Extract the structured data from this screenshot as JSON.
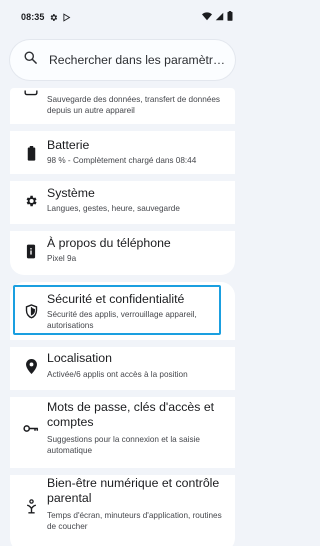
{
  "status_bar": {
    "time": "08:35"
  },
  "search": {
    "placeholder": "Rechercher dans les paramètr…"
  },
  "items": [
    {
      "title": "",
      "subtitle": "Sauvegarde des données, transfert de données depuis un autre appareil",
      "icon": "backup-icon"
    },
    {
      "title": "Batterie",
      "subtitle": "98 % - Complètement chargé dans 08:44",
      "icon": "battery-icon"
    },
    {
      "title": "Système",
      "subtitle": "Langues, gestes, heure, sauvegarde",
      "icon": "gear-icon"
    },
    {
      "title": "À propos du téléphone",
      "subtitle": "Pixel 9a",
      "icon": "phone-icon"
    },
    {
      "title": "Sécurité et confidentialité",
      "subtitle": "Sécurité des applis, verrouillage appareil, autorisations",
      "icon": "shield-icon"
    },
    {
      "title": "Localisation",
      "subtitle": "Activée/6 applis ont accès à la position",
      "icon": "location-pin-icon"
    },
    {
      "title": "Mots de passe, clés d'accès et comptes",
      "subtitle": "Suggestions pour la connexion et la saisie automatique",
      "icon": "key-icon"
    },
    {
      "title": "Bien-être numérique et contrôle parental",
      "subtitle": "Temps d'écran, minuteurs d'application, routines de coucher",
      "icon": "wellbeing-icon"
    }
  ],
  "colors": {
    "background": "#f1f4f9",
    "card": "#ffffff",
    "highlight": "#1a9fe0",
    "text_primary": "#1b1c1f",
    "text_secondary": "#45474c"
  }
}
